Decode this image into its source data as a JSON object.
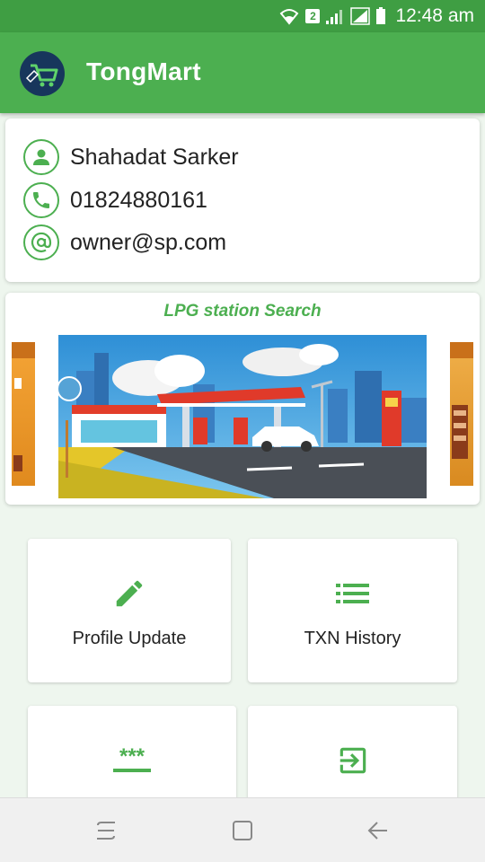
{
  "status_bar": {
    "time": "12:48 am",
    "sim_slot": "2"
  },
  "app_bar": {
    "title": "TongMart",
    "logo_icon": "shopping-cart-icon"
  },
  "profile": {
    "name": "Shahadat Sarker",
    "phone": "01824880161",
    "email": "owner@sp.com"
  },
  "banner": {
    "title": "LPG station Search"
  },
  "menu": {
    "profile_update": "Profile Update",
    "txn_history": "TXN History"
  },
  "colors": {
    "primary": "#4caf50",
    "status_bar": "#3f9e43",
    "logo_bg": "#17365c"
  }
}
